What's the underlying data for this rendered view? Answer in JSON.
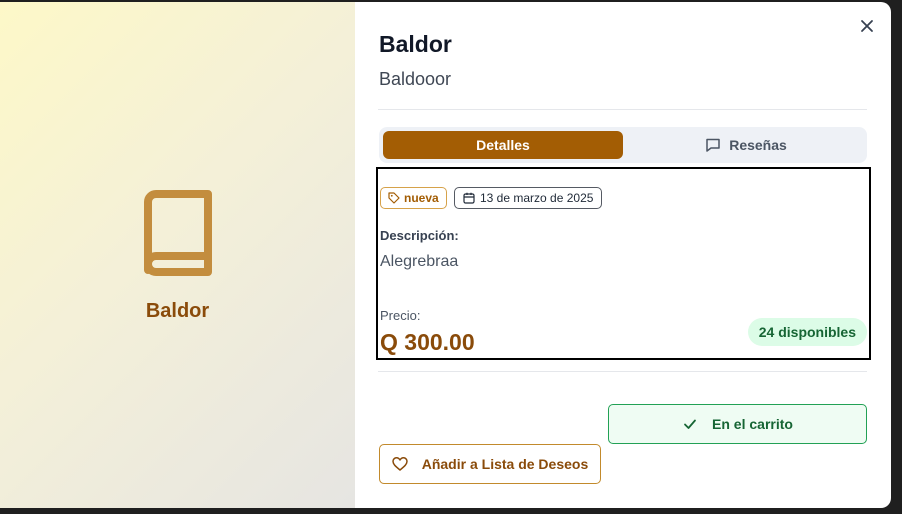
{
  "book": {
    "icon": "book-icon",
    "cover_title": "Baldor",
    "title": "Baldor",
    "subtitle": "Baldooor"
  },
  "tabs": [
    {
      "label": "Detalles",
      "icon": "",
      "active": true
    },
    {
      "label": "Reseñas",
      "icon": "message-square-icon",
      "active": false
    }
  ],
  "details": {
    "condition_badge": "nueva",
    "condition_icon": "tag-icon",
    "date_badge": "13 de marzo de 2025",
    "date_icon": "calendar-icon",
    "description_label": "Descripción:",
    "description": "Alegrebraa",
    "price_label": "Precio:",
    "price": "Q 300.00",
    "stock": "24 disponibles"
  },
  "actions": {
    "cart_label": "En el carrito",
    "cart_icon": "check-icon",
    "wishlist_label": "Añadir a Lista de Deseos",
    "wishlist_icon": "heart-icon",
    "close_icon": "close-icon"
  },
  "colors": {
    "accent": "#a35d04",
    "accent_text": "#8a4b0a",
    "success": "#166534",
    "success_bg": "#dcfce7"
  }
}
